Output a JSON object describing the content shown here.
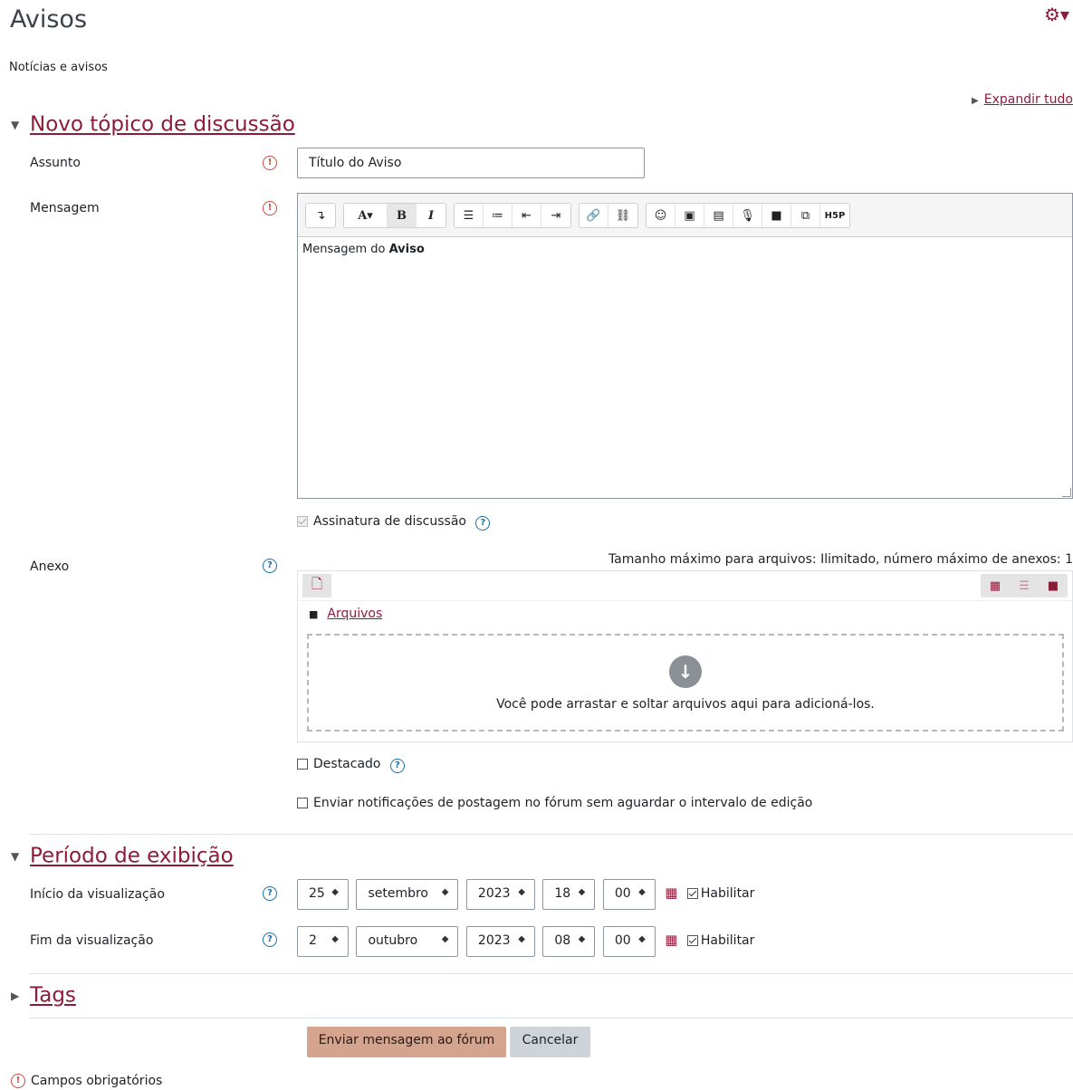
{
  "page": {
    "title": "Avisos",
    "subtitle": "Notícias e avisos",
    "expand_all": "Expandir tudo"
  },
  "sections": {
    "new_topic": "Novo tópico de discussão",
    "display_period": "Período de exibição",
    "tags": "Tags"
  },
  "form": {
    "subject_label": "Assunto",
    "subject_value": "Título do Aviso",
    "message_label": "Mensagem",
    "message_text_plain": "Mensagem do ",
    "message_text_bold": "Aviso",
    "discussion_subscription": "Assinatura de discussão",
    "attachment_label": "Anexo",
    "attachment_limits": "Tamanho máximo para arquivos: Ilimitado, número máximo de anexos: 1",
    "files_folder": "Arquivos",
    "dropzone_text": "Você pode arrastar e soltar arquivos aqui para adicioná-los.",
    "pinned": "Destacado",
    "send_notifications": "Enviar notificações de postagem no fórum sem aguardar o intervalo de edição",
    "start_label": "Início da visualização",
    "end_label": "Fim da visualização",
    "enable": "Habilitar",
    "start": {
      "day": "25",
      "month": "setembro",
      "year": "2023",
      "hour": "18",
      "minute": "00",
      "enabled": true
    },
    "end": {
      "day": "2",
      "month": "outubro",
      "year": "2023",
      "hour": "08",
      "minute": "00",
      "enabled": true
    },
    "submit_button": "Enviar mensagem ao fórum",
    "cancel_button": "Cancelar",
    "required_fields": "Campos obrigatórios"
  },
  "toolbar": {
    "groups": [
      [
        "show-more-icon"
      ],
      [
        "font-size-icon",
        "bold-icon",
        "italic-icon"
      ],
      [
        "unordered-list-icon",
        "ordered-list-icon",
        "outdent-icon",
        "indent-icon"
      ],
      [
        "link-icon",
        "unlink-icon"
      ],
      [
        "emoji-icon",
        "image-icon",
        "media-icon",
        "record-audio-icon",
        "record-video-icon",
        "manage-files-icon",
        "h5p-icon"
      ]
    ]
  },
  "colors": {
    "accent": "#8f1b3b",
    "primary_button": "#d4a48f",
    "secondary_button": "#ced4da",
    "required": "#cc4a3d",
    "help": "#1a6fa8"
  }
}
